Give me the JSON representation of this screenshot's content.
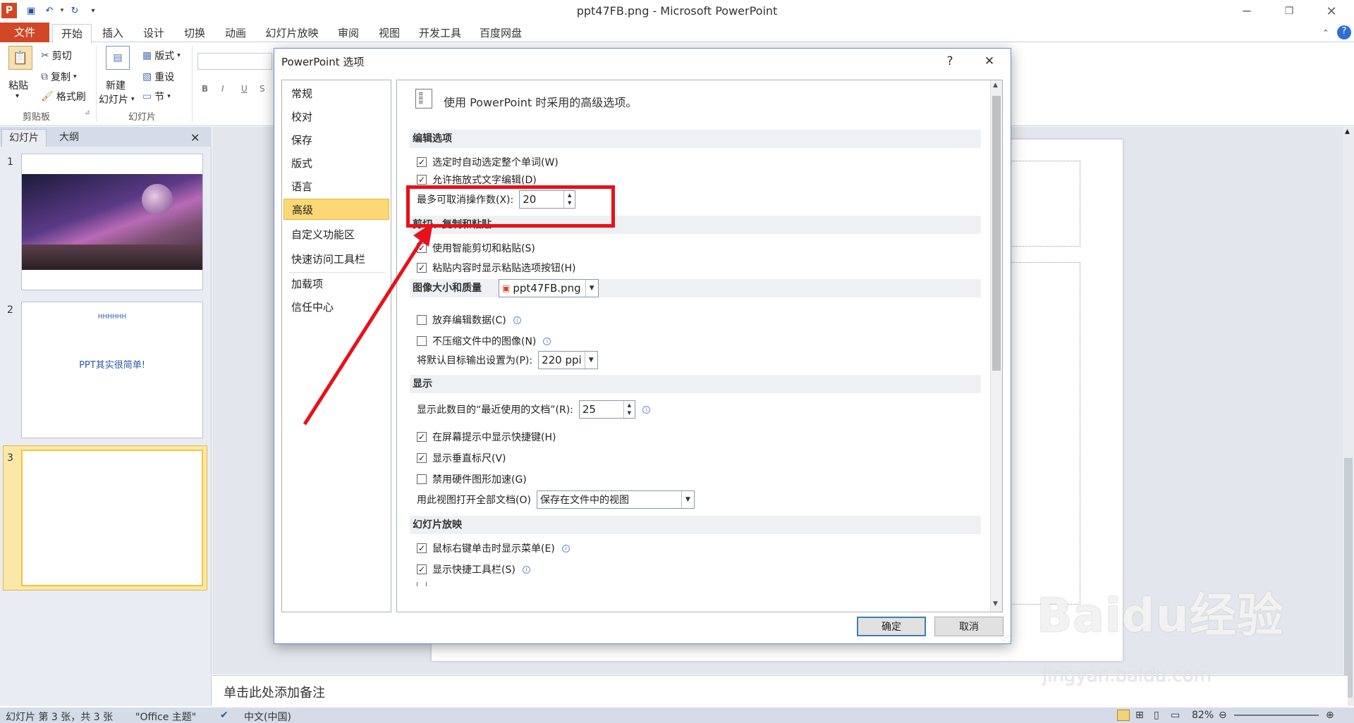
{
  "window": {
    "title": "ppt47FB.png - Microsoft PowerPoint"
  },
  "tabs": [
    {
      "label": "文件"
    },
    {
      "label": "开始"
    },
    {
      "label": "插入"
    },
    {
      "label": "设计"
    },
    {
      "label": "切换"
    },
    {
      "label": "动画"
    },
    {
      "label": "幻灯片放映"
    },
    {
      "label": "审阅"
    },
    {
      "label": "视图"
    },
    {
      "label": "开发工具"
    },
    {
      "label": "百度网盘"
    }
  ],
  "ribbon": {
    "paste": "粘贴",
    "cut": "剪切",
    "copy": "复制",
    "format_painter": "格式刷",
    "clipboard_label": "剪贴板",
    "new_slide_1": "新建",
    "new_slide_2": "幻灯片",
    "layout": "版式",
    "reset": "重设",
    "section": "节",
    "slides_label": "幻灯片"
  },
  "pane": {
    "tab_slides": "幻灯片",
    "tab_outline": "大纲"
  },
  "thumbnails": [
    {
      "num": "1"
    },
    {
      "num": "2",
      "line1": "HHHHHH",
      "line2": "PPT其实很简单!"
    },
    {
      "num": "3"
    }
  ],
  "notes": {
    "placeholder": "单击此处添加备注"
  },
  "status": {
    "slide_info": "幻灯片 第 3 张，共 3 张",
    "theme": "\"Office 主题\"",
    "language": "中文(中国)",
    "zoom": "82%"
  },
  "dialog": {
    "title": "PowerPoint 选项",
    "help": "?",
    "close": "✕",
    "nav": [
      "常规",
      "校对",
      "保存",
      "版式",
      "语言",
      "高级",
      "自定义功能区",
      "快速访问工具栏",
      "加载项",
      "信任中心"
    ],
    "header": "使用 PowerPoint 时采用的高级选项。",
    "sections": {
      "editing": "编辑选项",
      "clipboard": "剪切、复制和粘贴",
      "image": "图像大小和质量",
      "display": "显示",
      "slideshow": "幻灯片放映"
    },
    "options": {
      "auto_select_word": "选定时自动选定整个单词(W)",
      "drag_drop": "允许拖放式文字编辑(D)",
      "max_undo_label": "最多可取消操作数(X):",
      "max_undo_value": "20",
      "smart_cut": "使用智能剪切和粘贴(S)",
      "paste_options": "粘贴内容时显示粘贴选项按钮(H)",
      "image_file": "ppt47FB.png",
      "discard_edit": "放弃编辑数据(C)",
      "no_compress": "不压缩文件中的图像(N)",
      "default_output_label": "将默认目标输出设置为(P):",
      "default_output_value": "220 ppi",
      "recent_docs_label": "显示此数目的“最近使用的文档”(R):",
      "recent_docs_value": "25",
      "shortcut_tips": "在屏幕提示中显示快捷键(H)",
      "vertical_ruler": "显示垂直标尺(V)",
      "disable_hw": "禁用硬件图形加速(G)",
      "open_view_label": "用此视图打开全部文档(O)",
      "open_view_value": "保存在文件中的视图",
      "right_click_menu": "鼠标右键单击时显示菜单(E)",
      "popup_toolbar": "显示快捷工具栏(S)"
    },
    "ok": "确定",
    "cancel": "取消"
  },
  "watermark": {
    "main": "Baidu经验",
    "sub": "jingyan.baidu.com"
  },
  "colors": {
    "file_tab": "#d24726",
    "selected_nav": "#fcd874",
    "highlight": "#e8101a",
    "slide_sel": "#f5c342"
  }
}
